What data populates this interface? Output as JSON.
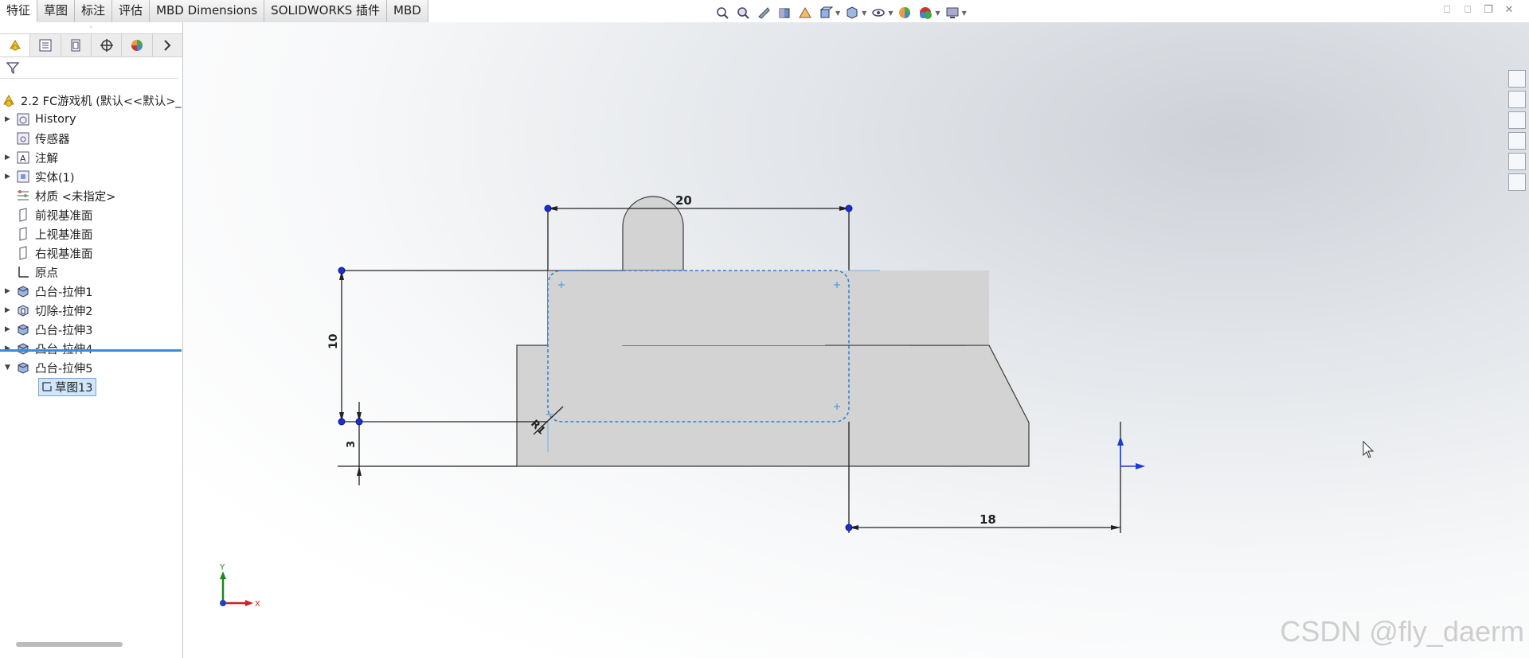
{
  "command_tabs": [
    "特征",
    "草图",
    "标注",
    "评估",
    "MBD Dimensions",
    "SOLIDWORKS 插件",
    "MBD"
  ],
  "panel": {
    "root_label": "2.2 FC游戏机 (默认<<默认>_",
    "tree": [
      {
        "label": "History",
        "expandable": true,
        "icon": "history-icon"
      },
      {
        "label": "传感器",
        "expandable": false,
        "icon": "sensor-icon"
      },
      {
        "label": "注解",
        "expandable": true,
        "icon": "annotation-icon"
      },
      {
        "label": "实体(1)",
        "expandable": true,
        "icon": "solid-body-icon"
      },
      {
        "label": "材质 <未指定>",
        "expandable": false,
        "icon": "material-icon"
      },
      {
        "label": "前视基准面",
        "expandable": false,
        "icon": "plane-icon"
      },
      {
        "label": "上视基准面",
        "expandable": false,
        "icon": "plane-icon"
      },
      {
        "label": "右视基准面",
        "expandable": false,
        "icon": "plane-icon"
      },
      {
        "label": "原点",
        "expandable": false,
        "icon": "origin-icon"
      },
      {
        "label": "凸台-拉伸1",
        "expandable": true,
        "icon": "boss-extrude-icon"
      },
      {
        "label": "切除-拉伸2",
        "expandable": true,
        "icon": "cut-extrude-icon"
      },
      {
        "label": "凸台-拉伸3",
        "expandable": true,
        "icon": "boss-extrude-icon"
      },
      {
        "label": "凸台-拉伸4",
        "expandable": true,
        "icon": "boss-extrude-icon"
      },
      {
        "label": "凸台-拉伸5",
        "expandable": true,
        "expanded": true,
        "icon": "boss-extrude-icon"
      }
    ],
    "selected_child": "草图13"
  },
  "dimensions": {
    "top": "20",
    "left": "10",
    "bottom_left": "3",
    "right": "18",
    "fillet": "R1"
  },
  "triad": {
    "x": "X",
    "y": "Y"
  },
  "watermark": "CSDN @fly_daerm"
}
